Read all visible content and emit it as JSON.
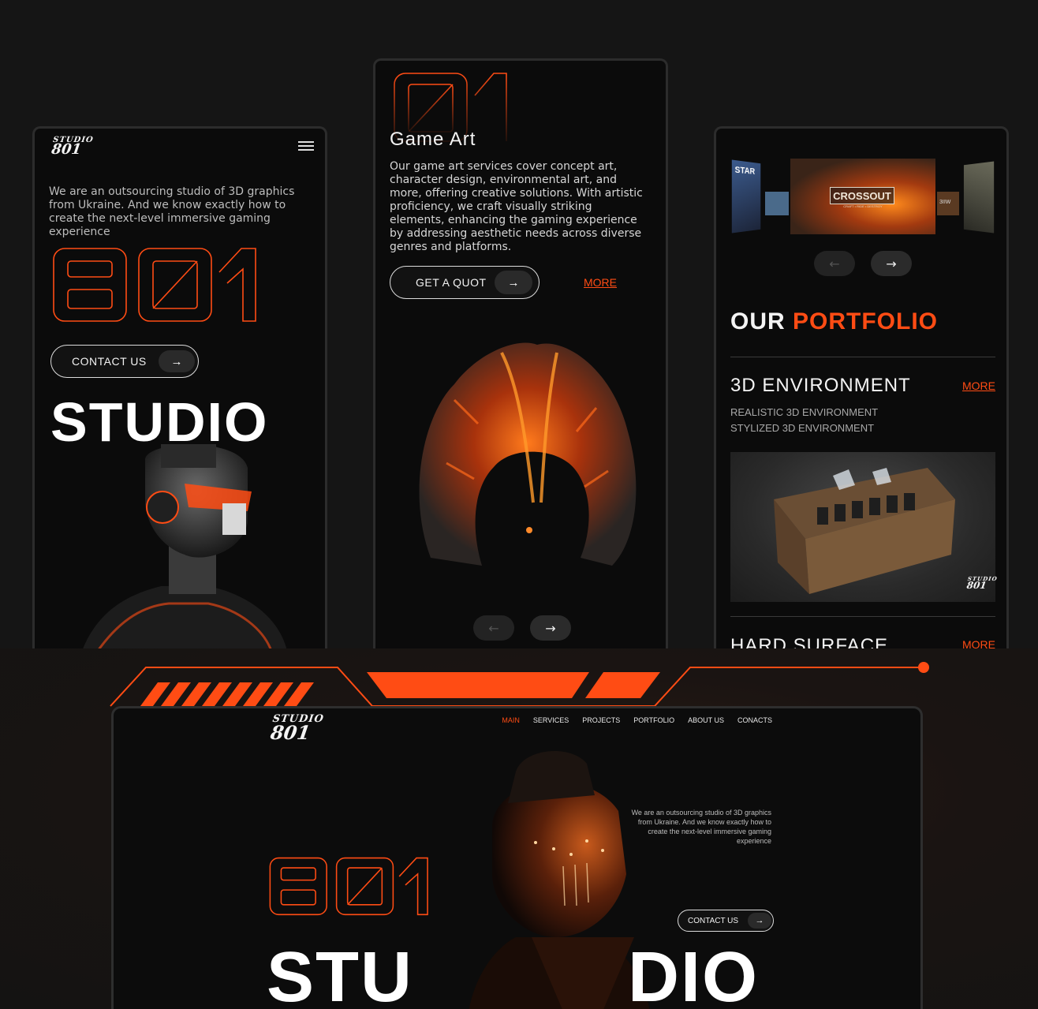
{
  "colors": {
    "accent": "#ff4c14",
    "background": "#0b0b0b",
    "text": "#f4f4f4"
  },
  "brand": {
    "logo_line1": "STUDIO",
    "logo_line2": "801"
  },
  "phone1": {
    "intro": "We are an outsourcing studio of 3D graphics from Ukraine. And we know exactly how to create the next-level immersive gaming experience",
    "big_number": "801",
    "contact_label": "CONTACT US",
    "studio_word": "STUDIO"
  },
  "phone2": {
    "number": "01",
    "title": "Game Art",
    "description": "Our game art services cover concept art, character design, environmental art, and more, offering creative solutions. With artistic proficiency, we craft visually striking elements, enhancing the gaming experience by addressing aesthetic needs across diverse genres and platforms.",
    "quote_label": "GET A QUOT",
    "more_label": "MORE"
  },
  "phone3": {
    "carousel_left_title": "STAR",
    "carousel_center_title": "CROSSOUT",
    "carousel_center_sub": "CRAFT • RIDE • DESTROY",
    "carousel_right_title": "3IIW",
    "heading_white": "OUR",
    "heading_orange": "PORTFOLIO",
    "section1_title": "3D ENVIRONMENT",
    "section1_more": "MORE",
    "section1_items": [
      "REALISTIC 3D ENVIRONMENT",
      "STYLIZED 3D ENVIRONMENT"
    ],
    "section2_title": "HARD SURFACE",
    "section2_more": "MORE"
  },
  "desktop": {
    "nav": [
      "MAIN",
      "SERVICES",
      "PROJECTS",
      "PORTFOLIO",
      "ABOUT US",
      "CONACTS"
    ],
    "intro": "We are an outsourcing studio of 3D graphics from Ukraine. And we know exactly how to create the next-level immersive gaming experience",
    "big_number": "801",
    "contact_label": "CONTACT US",
    "studio_left": "STU",
    "studio_right": "DIO"
  },
  "icons": {
    "arrow_right": "→",
    "arrow_left": "←"
  }
}
